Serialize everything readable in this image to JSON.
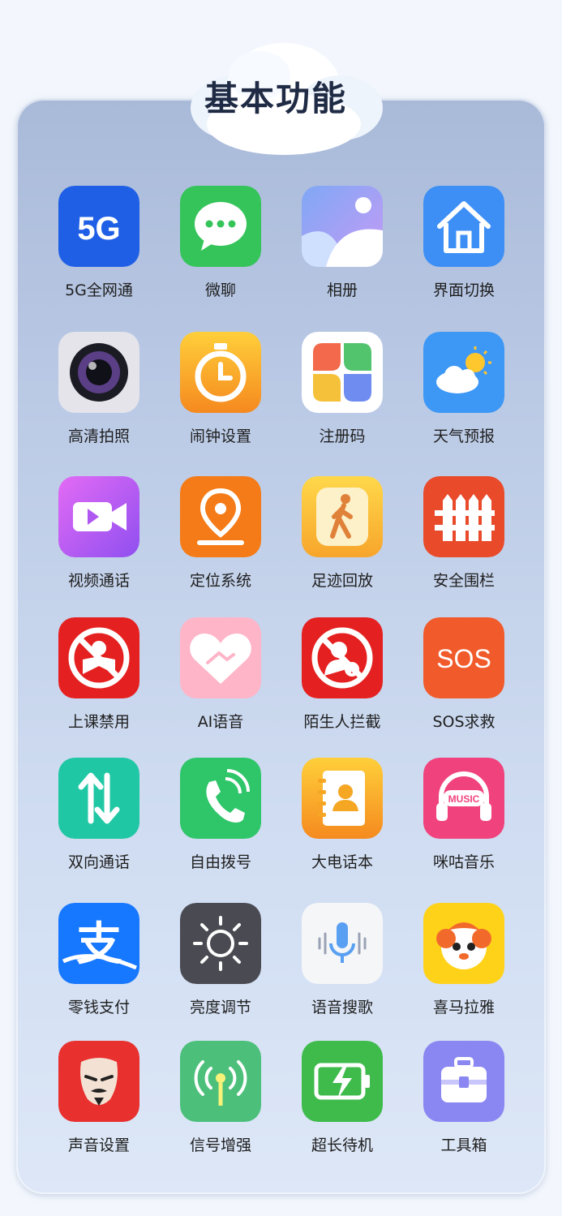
{
  "header": {
    "title": "基本功能"
  },
  "apps": [
    {
      "label": "5G全网通",
      "icon": "5g-icon",
      "color": "#1f5fe6",
      "text": "5G"
    },
    {
      "label": "微聊",
      "icon": "chat-bubble-icon",
      "color": "#35c45a"
    },
    {
      "label": "相册",
      "icon": "gallery-icon",
      "color": "#9b8cf0"
    },
    {
      "label": "界面切换",
      "icon": "home-icon",
      "color": "#3d8ff5"
    },
    {
      "label": "高清拍照",
      "icon": "camera-lens-icon",
      "color": "#e4e4ea"
    },
    {
      "label": "闹钟设置",
      "icon": "stopwatch-icon",
      "color": "#f5a623"
    },
    {
      "label": "注册码",
      "icon": "four-petal-icon",
      "color": "#ffffff"
    },
    {
      "label": "天气预报",
      "icon": "weather-icon",
      "color": "#3d97f5"
    },
    {
      "label": "视频通话",
      "icon": "video-camera-icon",
      "color": "#b05cf2"
    },
    {
      "label": "定位系统",
      "icon": "location-pin-icon",
      "color": "#f47b17"
    },
    {
      "label": "足迹回放",
      "icon": "walking-person-icon",
      "color": "#f8c43a"
    },
    {
      "label": "安全围栏",
      "icon": "fence-icon",
      "color": "#e84a2a"
    },
    {
      "label": "上课禁用",
      "icon": "no-reading-icon",
      "color": "#e52020"
    },
    {
      "label": "AI语音",
      "icon": "heart-handshake-icon",
      "color": "#ffb5c8"
    },
    {
      "label": "陌生人拦截",
      "icon": "block-stranger-icon",
      "color": "#e52020"
    },
    {
      "label": "SOS求救",
      "icon": "sos-icon",
      "color": "#f15a2b",
      "text": "SOS"
    },
    {
      "label": "双向通话",
      "icon": "two-way-arrows-icon",
      "color": "#20c7a4"
    },
    {
      "label": "自由拨号",
      "icon": "phone-icon",
      "color": "#2fc66a"
    },
    {
      "label": "大电话本",
      "icon": "contacts-book-icon",
      "color": "#f5a623"
    },
    {
      "label": "咪咕音乐",
      "icon": "music-headphones-icon",
      "color": "#f0437d",
      "text": "MUSIC"
    },
    {
      "label": "零钱支付",
      "icon": "alipay-icon",
      "color": "#1677ff",
      "text": "支"
    },
    {
      "label": "亮度调节",
      "icon": "brightness-icon",
      "color": "#4a4a52"
    },
    {
      "label": "语音搜歌",
      "icon": "microphone-icon",
      "color": "#f5f6f8"
    },
    {
      "label": "喜马拉雅",
      "icon": "cartoon-mascot-icon",
      "color": "#ffd21a"
    },
    {
      "label": "声音设置",
      "icon": "mask-icon",
      "color": "#e8312f"
    },
    {
      "label": "信号增强",
      "icon": "signal-antenna-icon",
      "color": "#4cc07a"
    },
    {
      "label": "超长待机",
      "icon": "battery-charge-icon",
      "color": "#3fbb4c"
    },
    {
      "label": "工具箱",
      "icon": "toolbox-icon",
      "color": "#8a86f2"
    }
  ]
}
